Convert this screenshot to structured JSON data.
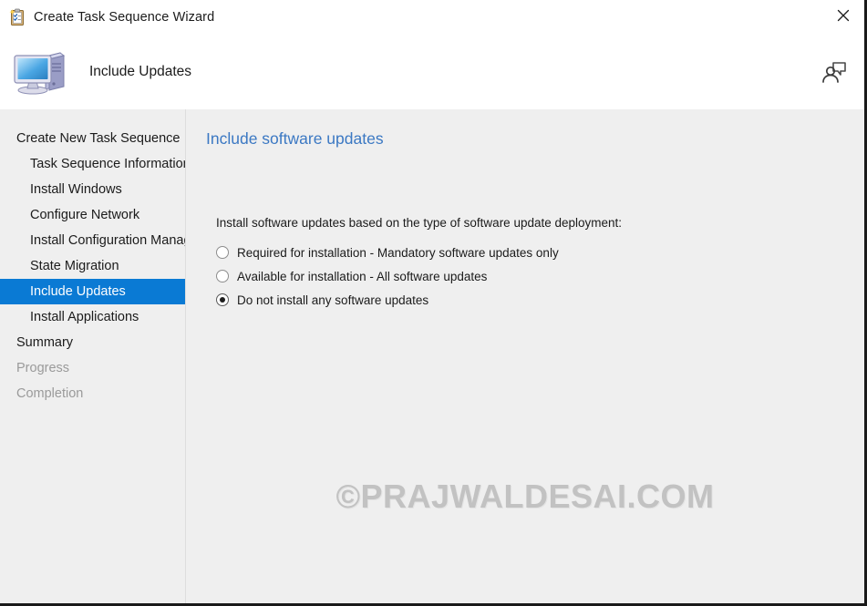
{
  "window": {
    "title": "Create Task Sequence Wizard",
    "title_icon": "clipboard-checklist-icon",
    "close_icon": "close-icon"
  },
  "header": {
    "title": "Include Updates",
    "icon": "computer-monitor-icon",
    "help_icon": "person-speech-bubble-icon"
  },
  "sidebar": {
    "items": [
      {
        "label": "Create New Task Sequence",
        "level": 0,
        "state": "normal"
      },
      {
        "label": "Task Sequence Information",
        "level": 1,
        "state": "normal"
      },
      {
        "label": "Install Windows",
        "level": 1,
        "state": "normal"
      },
      {
        "label": "Configure Network",
        "level": 1,
        "state": "normal"
      },
      {
        "label": "Install Configuration Manager",
        "level": 1,
        "state": "normal"
      },
      {
        "label": "State Migration",
        "level": 1,
        "state": "normal"
      },
      {
        "label": "Include Updates",
        "level": 1,
        "state": "selected"
      },
      {
        "label": "Install Applications",
        "level": 1,
        "state": "normal"
      },
      {
        "label": "Summary",
        "level": 0,
        "state": "normal"
      },
      {
        "label": "Progress",
        "level": 0,
        "state": "disabled"
      },
      {
        "label": "Completion",
        "level": 0,
        "state": "disabled"
      }
    ]
  },
  "content": {
    "heading": "Include software updates",
    "instruction": "Install software updates based on the type of software update deployment:",
    "radio_options": [
      {
        "label": "Required for installation - Mandatory software updates only",
        "checked": false
      },
      {
        "label": "Available for installation - All software updates",
        "checked": false
      },
      {
        "label": "Do not install any software updates",
        "checked": true
      }
    ]
  },
  "watermark": {
    "text": "©PRAJWALDESAI.COM"
  },
  "colors": {
    "selection_blue": "#0a7ad4",
    "heading_blue": "#3b78c3",
    "body_background": "#efefef",
    "titlebar_background": "#ffffff",
    "disabled_text": "#9a9a9a",
    "watermark_gray": "#c2c2c2"
  }
}
